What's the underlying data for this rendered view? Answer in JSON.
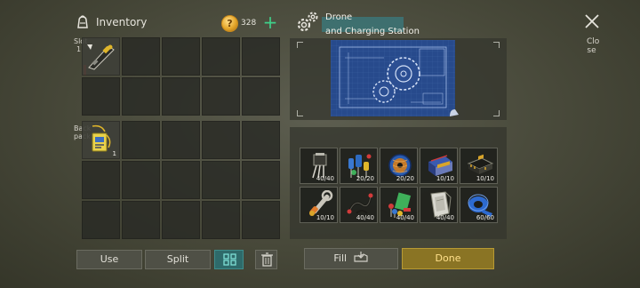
{
  "inventory": {
    "title": "Inventory",
    "coins": "328",
    "equipped_label": [
      "Slot",
      "1"
    ],
    "bag_label": [
      "Back",
      "pack"
    ],
    "equipped_slots": [
      {
        "item": "drone-remote-icon",
        "qty": ""
      },
      {
        "item": "",
        "qty": ""
      },
      {
        "item": "",
        "qty": ""
      },
      {
        "item": "",
        "qty": ""
      },
      {
        "item": "",
        "qty": ""
      },
      {
        "item": "",
        "qty": ""
      },
      {
        "item": "",
        "qty": ""
      },
      {
        "item": "",
        "qty": ""
      },
      {
        "item": "",
        "qty": ""
      },
      {
        "item": "",
        "qty": ""
      }
    ],
    "bag_slots": [
      {
        "item": "access-card-icon",
        "qty": "1"
      },
      {
        "item": "",
        "qty": ""
      },
      {
        "item": "",
        "qty": ""
      },
      {
        "item": "",
        "qty": ""
      },
      {
        "item": "",
        "qty": ""
      },
      {
        "item": "",
        "qty": ""
      },
      {
        "item": "",
        "qty": ""
      },
      {
        "item": "",
        "qty": ""
      },
      {
        "item": "",
        "qty": ""
      },
      {
        "item": "",
        "qty": ""
      },
      {
        "item": "",
        "qty": ""
      },
      {
        "item": "",
        "qty": ""
      },
      {
        "item": "",
        "qty": ""
      },
      {
        "item": "",
        "qty": ""
      },
      {
        "item": "",
        "qty": ""
      }
    ],
    "use_label": "Use",
    "split_label": "Split"
  },
  "crafting": {
    "recipe_line1": "Drone",
    "recipe_line2": "and Charging Station",
    "fill_label": "Fill",
    "done_label": "Done",
    "materials": [
      {
        "icon": "transistor-icon",
        "qty": "40/40"
      },
      {
        "icon": "capacitor-icon",
        "qty": "20/20"
      },
      {
        "icon": "wire-spool-icon",
        "qty": "20/20"
      },
      {
        "icon": "battery-pack-icon",
        "qty": "10/10"
      },
      {
        "icon": "circuit-chip-icon",
        "qty": "10/10"
      },
      {
        "icon": "wrench-icon",
        "qty": "10/10"
      },
      {
        "icon": "cable-icon",
        "qty": "40/40"
      },
      {
        "icon": "led-components-icon",
        "qty": "40/40"
      },
      {
        "icon": "metal-sheet-icon",
        "qty": "40/40"
      },
      {
        "icon": "tape-roll-icon",
        "qty": "60/60"
      }
    ]
  },
  "close": {
    "label": [
      "Clo",
      "se"
    ]
  },
  "colors": {
    "accent_teal": "#3d7374",
    "done_gold": "#8a7424",
    "coin_plus": "#3fd08a"
  }
}
